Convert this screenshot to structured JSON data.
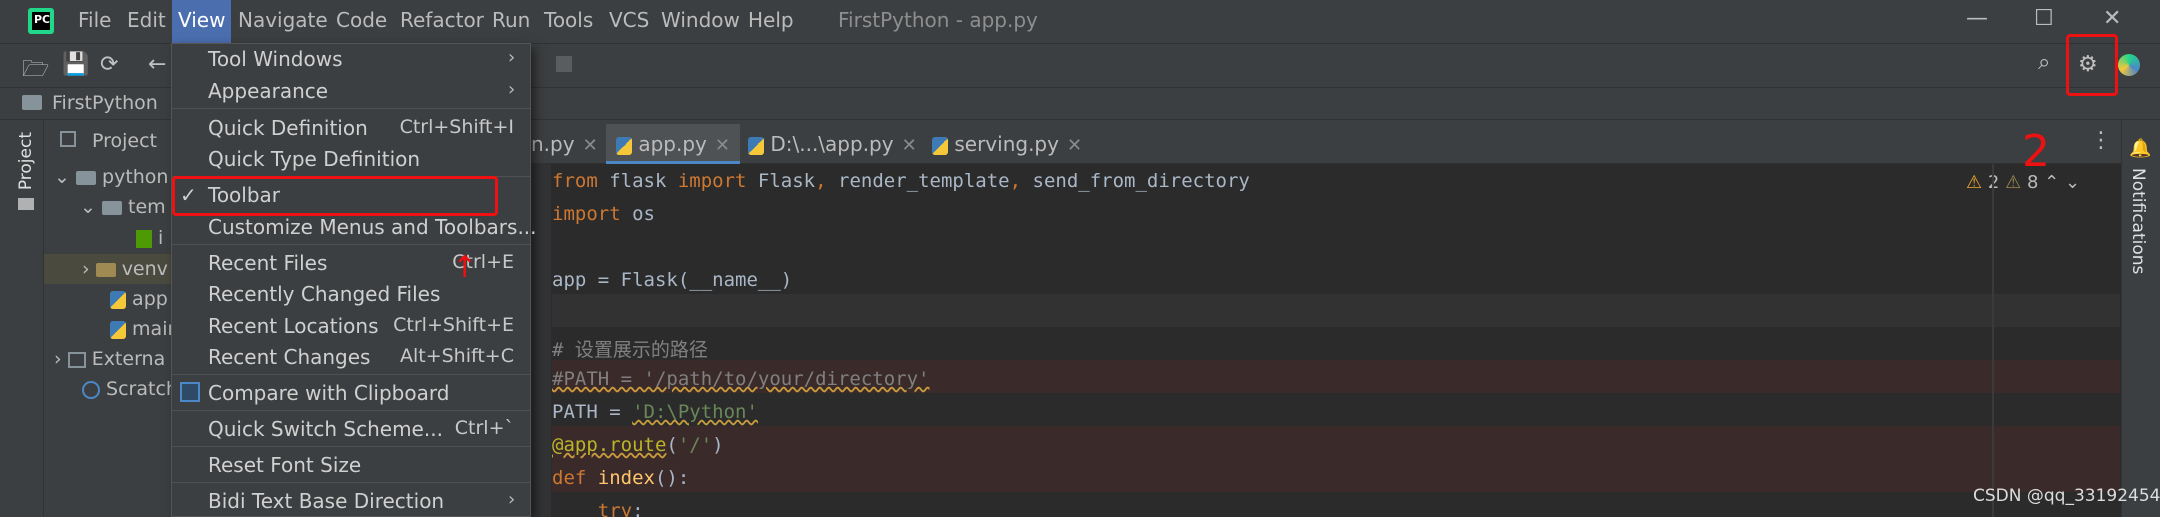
{
  "menubar": {
    "items": [
      "File",
      "Edit",
      "View",
      "Navigate",
      "Code",
      "Refactor",
      "Run",
      "Tools",
      "VCS",
      "Window",
      "Help"
    ],
    "window_title": "FirstPython - app.py",
    "logo_text": "PC"
  },
  "navbar": {
    "project": "FirstPython"
  },
  "side": {
    "project_tab": "Project",
    "notifications_tab": "Notifications"
  },
  "project_panel": {
    "header": "Project",
    "items": [
      "python",
      "tem",
      "i",
      "venv",
      "app",
      "main",
      "Externa",
      "Scratch"
    ]
  },
  "tabs": [
    {
      "label": "n.py",
      "active": false
    },
    {
      "label": "app.py",
      "active": true
    },
    {
      "label": "D:\\...\\app.py",
      "active": false
    },
    {
      "label": "serving.py",
      "active": false
    }
  ],
  "inspections": {
    "warnings": "2",
    "weak_warnings": "8"
  },
  "code": [
    "from flask import Flask, render_template, send_from_directory",
    "import os",
    "",
    "app = Flask(__name__)",
    "",
    "# 设置展示的路径",
    "#PATH = '/path/to/your/directory'",
    "PATH = 'D:\\Python'",
    "@app.route('/')",
    "def index():",
    "    try:"
  ],
  "view_menu": {
    "items": [
      {
        "label": "Tool Windows",
        "shortcut": "",
        "submenu": true
      },
      {
        "label": "Appearance",
        "shortcut": "",
        "submenu": true
      },
      {
        "label": "Quick Definition",
        "shortcut": "Ctrl+Shift+I"
      },
      {
        "label": "Quick Type Definition",
        "shortcut": ""
      },
      {
        "label": "Toolbar",
        "shortcut": "",
        "checked": true
      },
      {
        "label": "Customize Menus and Toolbars...",
        "shortcut": ""
      },
      {
        "label": "Recent Files",
        "shortcut": "Ctrl+E"
      },
      {
        "label": "Recently Changed Files",
        "shortcut": ""
      },
      {
        "label": "Recent Locations",
        "shortcut": "Ctrl+Shift+E"
      },
      {
        "label": "Recent Changes",
        "shortcut": "Alt+Shift+C"
      },
      {
        "label": "Compare with Clipboard",
        "shortcut": ""
      },
      {
        "label": "Quick Switch Scheme...",
        "shortcut": "Ctrl+`"
      },
      {
        "label": "Reset Font Size",
        "shortcut": ""
      },
      {
        "label": "Bidi Text Base Direction",
        "shortcut": "",
        "submenu": true
      }
    ]
  },
  "annotations": {
    "arrow": "↑",
    "number": "2"
  },
  "watermark": "CSDN @qq_33192454",
  "colors": {
    "accent": "#4b6eaf",
    "annotation": "#ee1111",
    "tab_underline": "#4a88c7"
  }
}
